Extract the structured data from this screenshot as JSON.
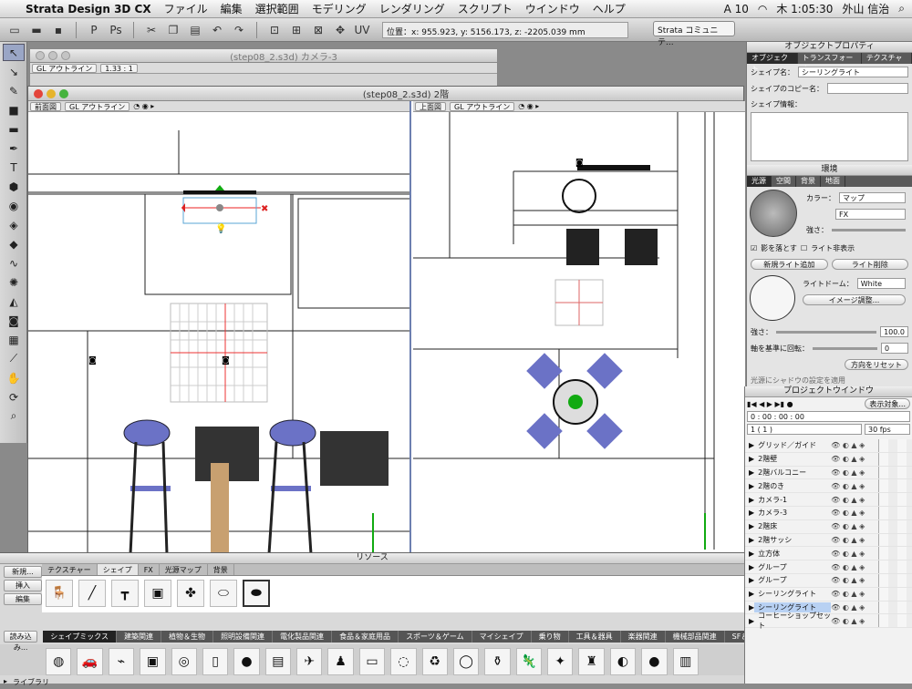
{
  "menubar": {
    "app": "Strata Design 3D CX",
    "items": [
      "ファイル",
      "編集",
      "選択範囲",
      "モデリング",
      "レンダリング",
      "スクリプト",
      "ウインドウ",
      "ヘルプ"
    ],
    "status": {
      "input": "A 10",
      "clock": "木 1:05:30",
      "user": "外山 信治"
    }
  },
  "toolbar": {
    "coords": "位置：x: 955.923, y: 5156.173, z: -2205.039 mm",
    "community": "Strata コミュニテ..."
  },
  "win_back": {
    "title": "(step08_2.s3d) カメラ-3",
    "mode": "GL アウトライン",
    "zoom": "1.33 : 1"
  },
  "win_main": {
    "title": "(step08_2.s3d) 2階",
    "left": {
      "view": "前面図",
      "mode": "GL アウトライン"
    },
    "right": {
      "view": "上面図",
      "mode": "GL アウトライン"
    }
  },
  "props": {
    "title": "オブジェクトプロパティ",
    "tabs": [
      "オブジェクト",
      "トランスフォーム",
      "テクスチャー"
    ],
    "shape_name_label": "シェイプ名：",
    "shape_name": "シーリングライト",
    "copy_label": "シェイプのコピー名：",
    "info_label": "シェイプ情報："
  },
  "env": {
    "title": "環境",
    "tabs": [
      "光源",
      "空間",
      "背景",
      "地面"
    ],
    "color_label": "カラー：",
    "map": "マップ",
    "fx": "FX",
    "strength_label": "強さ：",
    "shadow": "影を落とす",
    "light_display": "ライト非表示",
    "add_light": "新規ライト追加",
    "del_light": "ライト削除",
    "dome_label": "ライトドーム：",
    "dome": "White",
    "image_adjust": "イメージ調整...",
    "strength2": "100.0",
    "rotate_label": "軸を基準に回転：",
    "rotate": "0",
    "reset_dir": "方向をリセット",
    "hint": "光源にシャドウの設定を適用"
  },
  "project": {
    "title": "プロジェクトウインドウ",
    "display": "表示対象...",
    "time": "0 : 00 : 00 : 00",
    "frame": "1 ( 1 )",
    "fps": "30 fps",
    "layers": [
      "グリッド／ガイド",
      "2階壁",
      "2階バルコニー",
      "2階のき",
      "カメラ-1",
      "カメラ-3",
      "2階床",
      "2階サッシ",
      "立方体",
      "グループ",
      "グループ",
      "シーリングライト",
      "シーリングライト",
      "コーヒーショップセット"
    ],
    "selected_index": 12
  },
  "resources": {
    "title": "リソース",
    "tabs": [
      "テクスチャー",
      "シェイプ",
      "FX",
      "光源マップ",
      "背景"
    ],
    "active_tab": 1,
    "side_buttons": [
      "新規...",
      "挿入",
      "編集"
    ],
    "load": "読み込み...",
    "library": "ライブラリ",
    "categories": [
      "シェイプミックス",
      "建築関連",
      "植物＆生物",
      "照明設備関連",
      "電化製品関連",
      "食品＆家庭用品",
      "スポーツ＆ゲーム",
      "マイシェイプ",
      "乗り物",
      "工具＆器具",
      "楽器関連",
      "機械部品関連",
      "SF＆ファンタジー",
      "その他"
    ]
  }
}
